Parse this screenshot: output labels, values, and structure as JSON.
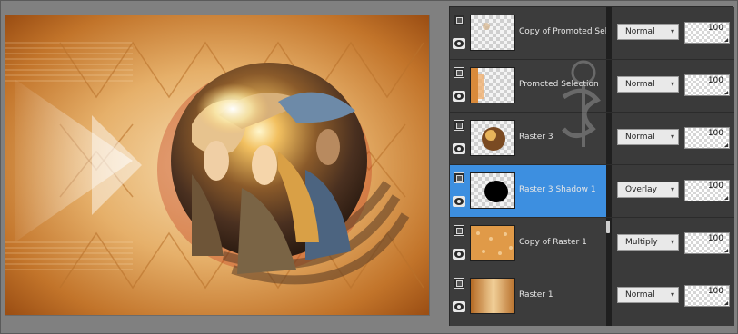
{
  "layers": [
    {
      "name": "Copy of Promoted Selection",
      "blend": "Normal",
      "opacity": "100",
      "selected": false,
      "thumb": "transparent-dot"
    },
    {
      "name": "Promoted Selection",
      "blend": "Normal",
      "opacity": "100",
      "selected": false,
      "thumb": "orange-edge"
    },
    {
      "name": "Raster 3",
      "blend": "Normal",
      "opacity": "100",
      "selected": false,
      "thumb": "round-artwork"
    },
    {
      "name": "Raster 3 Shadow 1",
      "blend": "Overlay",
      "opacity": "100",
      "selected": true,
      "thumb": "black-shadow"
    },
    {
      "name": "Copy of Raster 1",
      "blend": "Multiply",
      "opacity": "100",
      "selected": false,
      "thumb": "orange-texture"
    },
    {
      "name": "Raster 1",
      "blend": "Normal",
      "opacity": "100",
      "selected": false,
      "thumb": "warm-gradient"
    }
  ],
  "colors": {
    "selected": "#3d8fe0",
    "panel": "#3c3c3c",
    "accent_orange": "#d98a3a"
  },
  "icons": {
    "link": "layer-link-icon",
    "visibility": "eye-icon",
    "dropdown": "chevron-down-icon"
  }
}
